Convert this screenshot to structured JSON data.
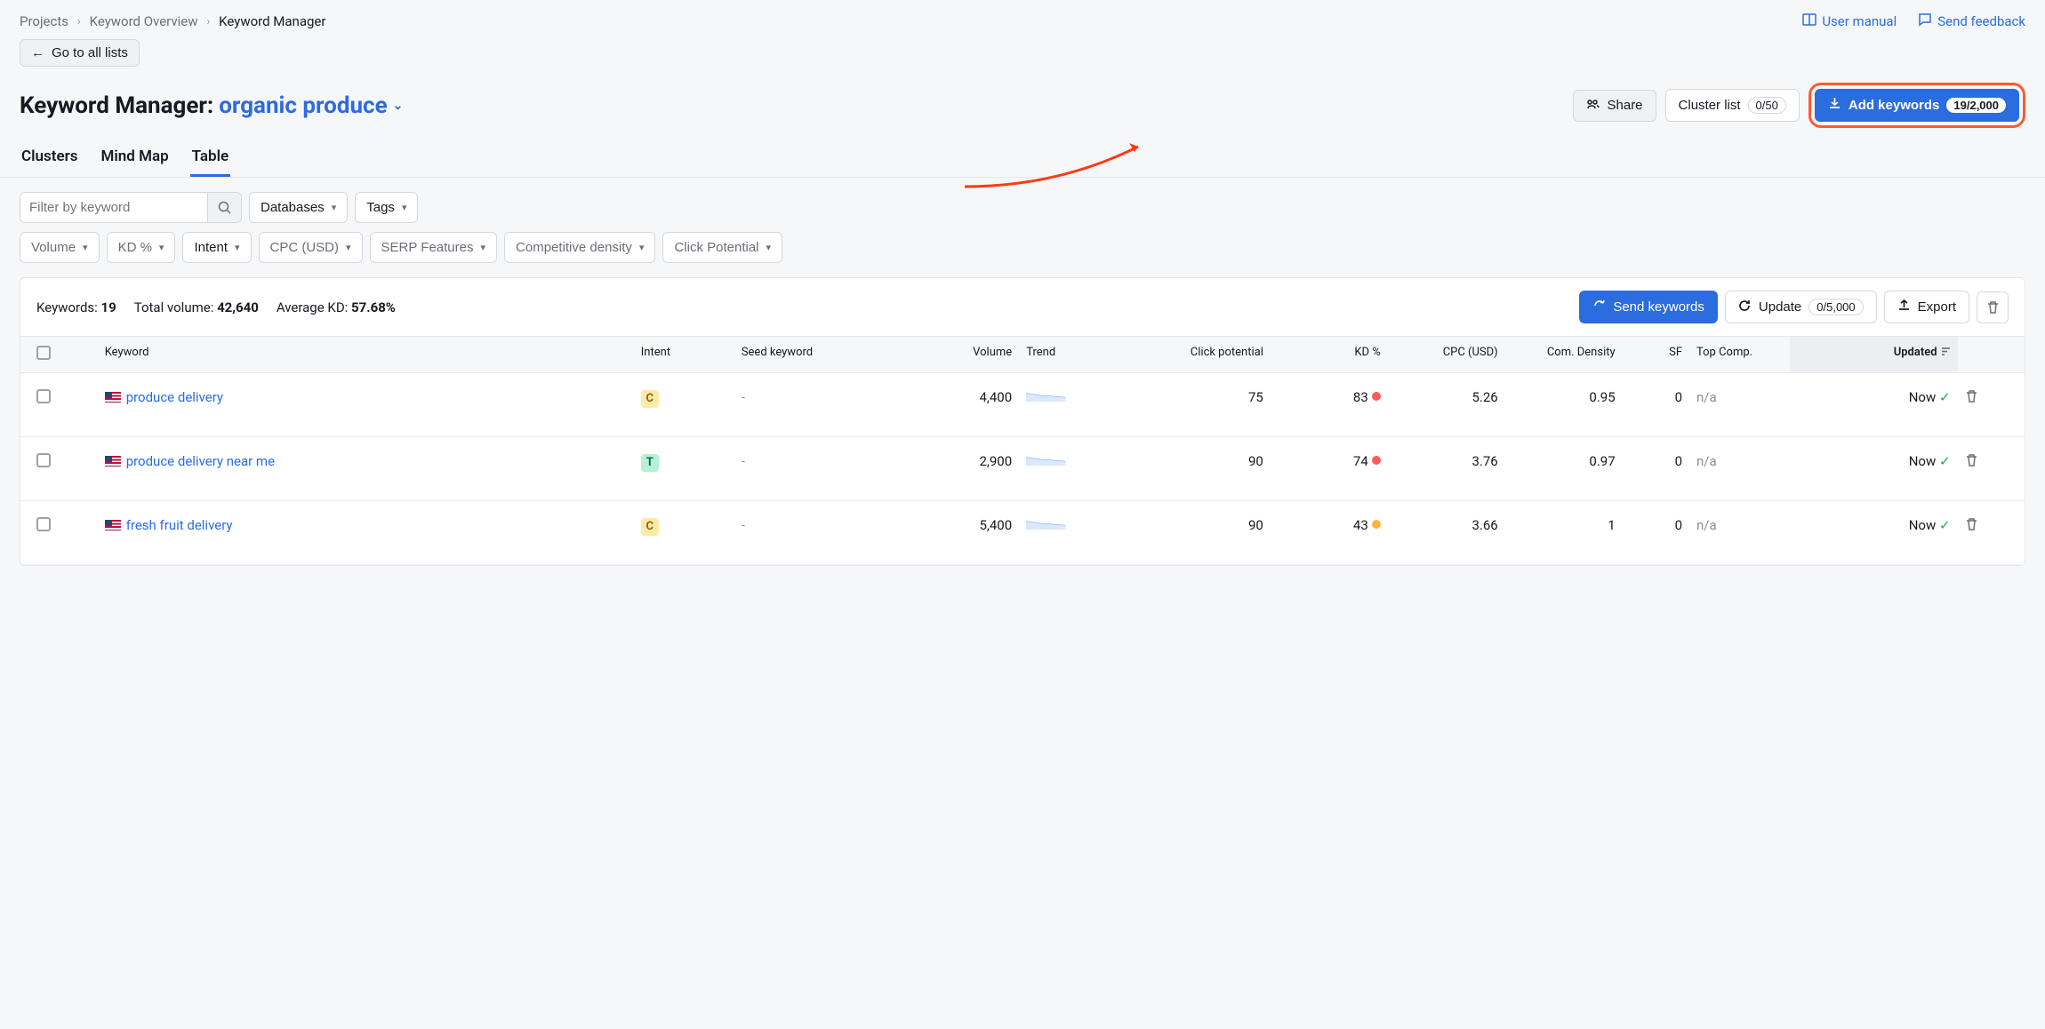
{
  "breadcrumb": {
    "items": [
      "Projects",
      "Keyword Overview",
      "Keyword Manager"
    ]
  },
  "top_links": {
    "user_manual": "User manual",
    "send_feedback": "Send feedback"
  },
  "back_button": "Go to all lists",
  "header": {
    "title_prefix": "Keyword Manager:",
    "project_name": "organic produce",
    "share": "Share",
    "cluster_list": "Cluster list",
    "cluster_badge": "0/50",
    "add_keywords": "Add keywords",
    "add_badge": "19/2,000"
  },
  "tabs": [
    "Clusters",
    "Mind Map",
    "Table"
  ],
  "active_tab": "Table",
  "filters": {
    "filter_placeholder": "Filter by keyword",
    "databases": "Databases",
    "tags": "Tags",
    "row2": [
      "Volume",
      "KD %",
      "Intent",
      "CPC (USD)",
      "SERP Features",
      "Competitive density",
      "Click Potential"
    ]
  },
  "stats": {
    "keywords_label": "Keywords:",
    "keywords_value": "19",
    "total_volume_label": "Total volume:",
    "total_volume_value": "42,640",
    "avg_kd_label": "Average KD:",
    "avg_kd_value": "57.68%"
  },
  "card_actions": {
    "send_keywords": "Send keywords",
    "update": "Update",
    "update_badge": "0/5,000",
    "export": "Export"
  },
  "columns": [
    "",
    "Keyword",
    "Intent",
    "Seed keyword",
    "Volume",
    "Trend",
    "Click potential",
    "KD %",
    "CPC (USD)",
    "Com. Density",
    "SF",
    "Top Comp.",
    "Updated",
    ""
  ],
  "rows": [
    {
      "keyword": "produce delivery",
      "intent": "C",
      "seed": "-",
      "volume": "4,400",
      "click_potential": "75",
      "kd": "83",
      "kd_dot": "red",
      "cpc": "5.26",
      "density": "0.95",
      "sf": "0",
      "top_comp": "n/a",
      "updated": "Now"
    },
    {
      "keyword": "produce delivery near me",
      "intent": "T",
      "seed": "-",
      "volume": "2,900",
      "click_potential": "90",
      "kd": "74",
      "kd_dot": "red",
      "cpc": "3.76",
      "density": "0.97",
      "sf": "0",
      "top_comp": "n/a",
      "updated": "Now"
    },
    {
      "keyword": "fresh fruit delivery",
      "intent": "C",
      "seed": "-",
      "volume": "5,400",
      "click_potential": "90",
      "kd": "43",
      "kd_dot": "amber",
      "cpc": "3.66",
      "density": "1",
      "sf": "0",
      "top_comp": "n/a",
      "updated": "Now"
    }
  ]
}
